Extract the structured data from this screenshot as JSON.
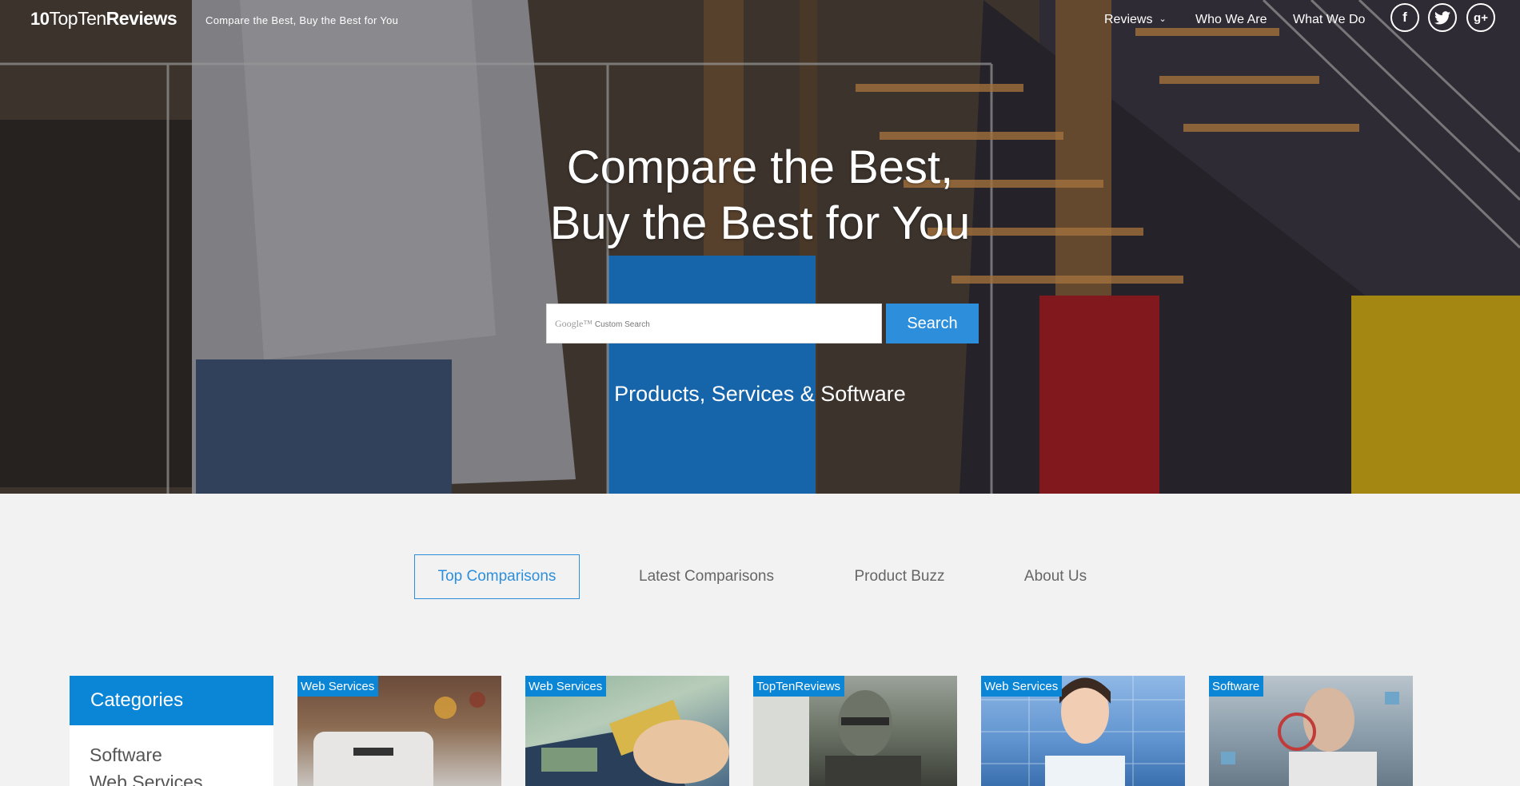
{
  "header": {
    "logo": {
      "ten": "10",
      "top": "Top",
      "ten_word": "Ten",
      "reviews": "Reviews"
    },
    "tagline": "Compare the Best, Buy the Best for You",
    "nav": [
      {
        "label": "Reviews"
      },
      {
        "label": "Who We Are"
      },
      {
        "label": "What We Do"
      }
    ],
    "social": [
      "f",
      "t",
      "g+"
    ]
  },
  "hero": {
    "title_line1": "Compare the Best,",
    "title_line2": "Buy the Best for You",
    "search_placeholder_brand": "Google™",
    "search_placeholder": "Custom Search",
    "search_button": "Search",
    "subtitle": "Products, Services & Software"
  },
  "tabs": [
    {
      "label": "Top Comparisons",
      "active": true
    },
    {
      "label": "Latest Comparisons"
    },
    {
      "label": "Product Buzz"
    },
    {
      "label": "About Us"
    }
  ],
  "categories": {
    "header": "Categories",
    "items": [
      "Software",
      "Web Services"
    ]
  },
  "cards": [
    {
      "badge": "Web Services"
    },
    {
      "badge": "Web Services"
    },
    {
      "badge": "TopTenReviews"
    },
    {
      "badge": "Web Services"
    },
    {
      "badge": "Software"
    }
  ],
  "colors": {
    "accent": "#2d8fdc",
    "badge": "#0b85d6"
  }
}
